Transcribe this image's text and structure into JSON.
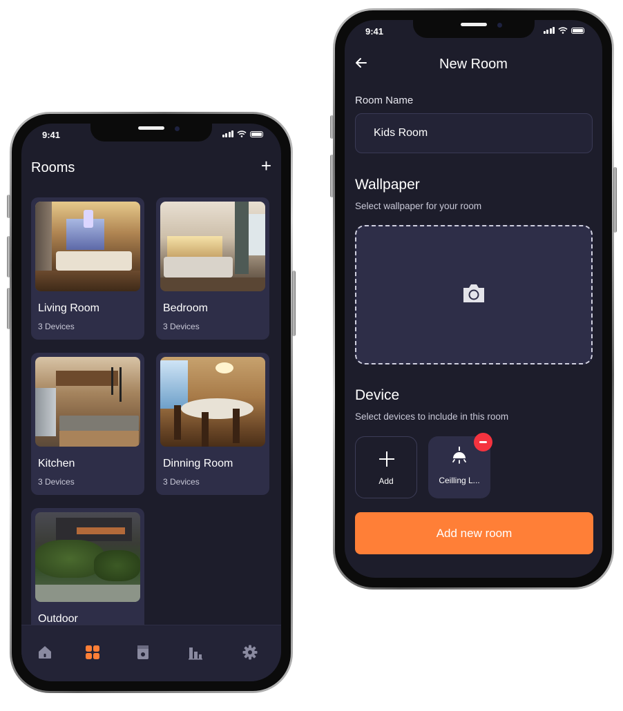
{
  "left_phone": {
    "status_time": "9:41",
    "header": {
      "title": "Rooms",
      "add_icon": "plus-icon"
    },
    "rooms": [
      {
        "name": "Living Room",
        "devices": "3 Devices",
        "image": "living-room-photo"
      },
      {
        "name": "Bedroom",
        "devices": "3 Devices",
        "image": "bedroom-photo"
      },
      {
        "name": "Kitchen",
        "devices": "3 Devices",
        "image": "kitchen-photo"
      },
      {
        "name": "Dinning Room",
        "devices": "3 Devices",
        "image": "dining-room-photo"
      },
      {
        "name": "Outdoor",
        "devices": "",
        "image": "outdoor-photo"
      }
    ],
    "tabbar": {
      "items": [
        "home-icon",
        "grid-icon",
        "device-icon",
        "stats-icon",
        "settings-icon"
      ],
      "active_index": 1,
      "active_color": "#ff7f37",
      "inactive_color": "#8a8aa0"
    }
  },
  "right_phone": {
    "status_time": "9:41",
    "header": {
      "title": "New Room",
      "back_icon": "arrow-left-icon"
    },
    "room_name": {
      "label": "Room Name",
      "value": "Kids Room"
    },
    "wallpaper": {
      "title": "Wallpaper",
      "subtitle": "Select wallpaper for your room",
      "icon": "camera-icon"
    },
    "device": {
      "title": "Device",
      "subtitle": "Select devices to include in this room",
      "tiles": [
        {
          "label": "Add",
          "icon": "plus-icon"
        },
        {
          "label": "Ceilling L...",
          "icon": "ceiling-light-icon",
          "remove_icon": "minus-icon"
        }
      ]
    },
    "submit": {
      "label": "Add new room"
    }
  },
  "colors": {
    "screen_bg": "#1d1d2b",
    "card_bg": "#2e2e48",
    "accent": "#ff7f37",
    "remove": "#f5333f"
  }
}
